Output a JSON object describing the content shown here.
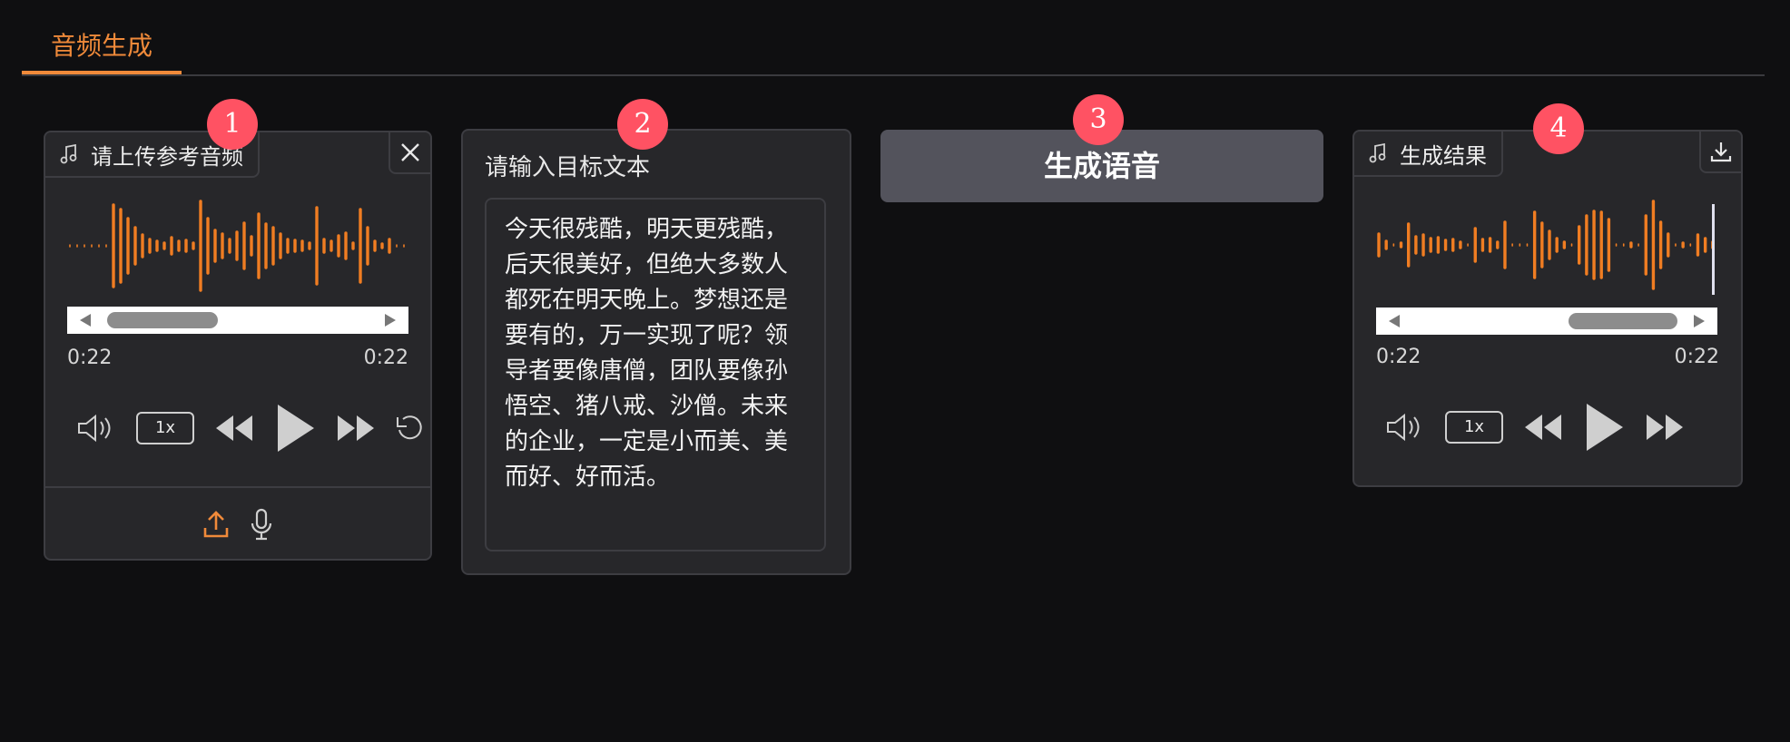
{
  "tabs": [
    {
      "label": "音频生成",
      "active": true
    }
  ],
  "steps": [
    "1",
    "2",
    "3",
    "4"
  ],
  "reference_audio": {
    "label": "请上传参考音频",
    "current_time": "0:22",
    "duration": "0:22",
    "speed": "1x"
  },
  "target_text": {
    "title": "请输入目标文本",
    "value": "今天很残酷，明天更残酷，后天很美好，但绝大多数人都死在明天晚上。梦想还是要有的，万一实现了呢？领导者要像唐僧，团队要像孙悟空、猪八戒、沙僧。未来的企业，一定是小而美、美而好、好而活。"
  },
  "generate_button": {
    "label": "生成语音"
  },
  "result_audio": {
    "label": "生成结果",
    "current_time": "0:22",
    "duration": "0:22",
    "speed": "1x"
  },
  "colors": {
    "accent": "#f08a3a",
    "badge": "#ff5263",
    "background": "#0f0f11",
    "panel": "#27272a"
  }
}
